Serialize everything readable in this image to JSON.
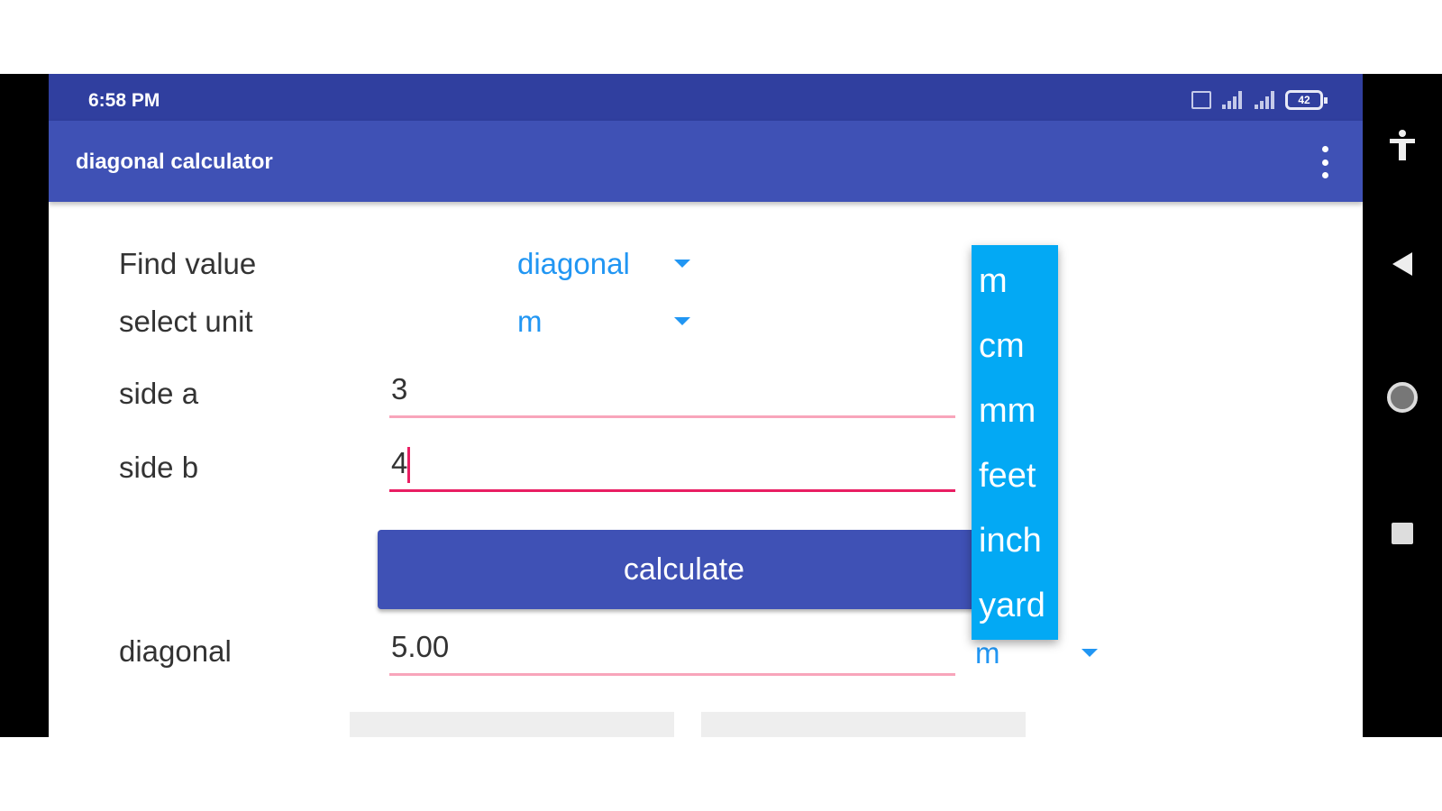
{
  "status_bar": {
    "time": "6:58 PM",
    "battery": "42"
  },
  "app_bar": {
    "title": "diagonal calculator"
  },
  "form": {
    "find_value_label": "Find value",
    "find_value_selected": "diagonal",
    "select_unit_label": "select unit",
    "select_unit_selected": "m",
    "side_a_label": "side a",
    "side_a_value": "3",
    "side_b_label": "side b",
    "side_b_value": "4",
    "calculate_label": "calculate",
    "diagonal_label": "diagonal",
    "diagonal_value": "5.00",
    "diagonal_unit": "m"
  },
  "unit_dropdown": {
    "options": [
      "m",
      "cm",
      "mm",
      "feet",
      "inch",
      "yard"
    ]
  },
  "colors": {
    "status_bar": "#303f9f",
    "app_bar": "#3f51b5",
    "accent": "#2196f3",
    "dropdown": "#03a9f4",
    "field_underline_focused": "#e91e63"
  }
}
